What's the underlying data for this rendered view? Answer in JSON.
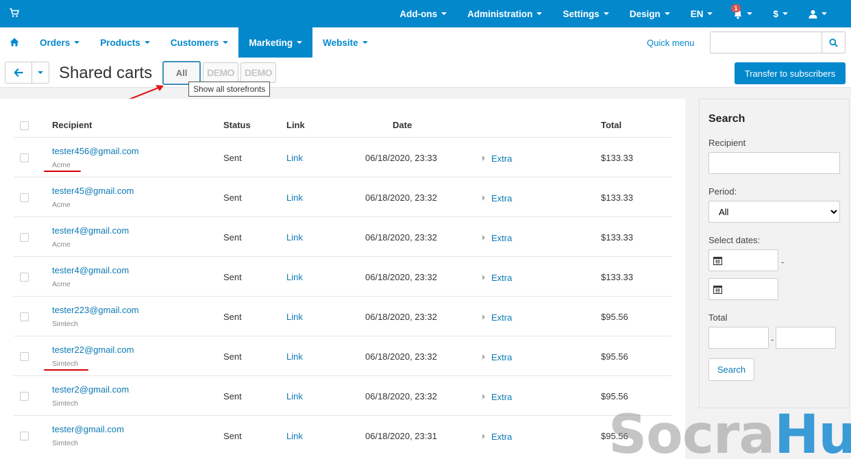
{
  "topbar": {
    "items": [
      {
        "label": "Add-ons"
      },
      {
        "label": "Administration"
      },
      {
        "label": "Settings"
      },
      {
        "label": "Design"
      },
      {
        "label": "EN"
      }
    ],
    "notification_count": "1",
    "currency": "$",
    "accent_color": "#0388cc"
  },
  "nav": {
    "items": [
      {
        "label": "Orders"
      },
      {
        "label": "Products"
      },
      {
        "label": "Customers"
      },
      {
        "label": "Marketing"
      },
      {
        "label": "Website"
      }
    ],
    "active": "Marketing",
    "quick_menu": "Quick menu",
    "search_placeholder": ""
  },
  "header": {
    "title": "Shared carts",
    "storefront_all": "All",
    "storefront_logos": [
      "DEMO",
      "DEMO"
    ],
    "tooltip": "Show all storefronts",
    "transfer_button": "Transfer to subscribers"
  },
  "table": {
    "columns": {
      "recipient": "Recipient",
      "status": "Status",
      "link": "Link",
      "date": "Date",
      "total": "Total"
    },
    "rows": [
      {
        "email": "tester456@gmail.com",
        "store": "Acme",
        "status": "Sent",
        "link": "Link",
        "date": "06/18/2020, 23:33",
        "extra": "Extra",
        "total": "$133.33"
      },
      {
        "email": "tester45@gmail.com",
        "store": "Acme",
        "status": "Sent",
        "link": "Link",
        "date": "06/18/2020, 23:32",
        "extra": "Extra",
        "total": "$133.33"
      },
      {
        "email": "tester4@gmail.com",
        "store": "Acme",
        "status": "Sent",
        "link": "Link",
        "date": "06/18/2020, 23:32",
        "extra": "Extra",
        "total": "$133.33"
      },
      {
        "email": "tester4@gmail.com",
        "store": "Acme",
        "status": "Sent",
        "link": "Link",
        "date": "06/18/2020, 23:32",
        "extra": "Extra",
        "total": "$133.33"
      },
      {
        "email": "tester223@gmail.com",
        "store": "Simtech",
        "status": "Sent",
        "link": "Link",
        "date": "06/18/2020, 23:32",
        "extra": "Extra",
        "total": "$95.56"
      },
      {
        "email": "tester22@gmail.com",
        "store": "Simtech",
        "status": "Sent",
        "link": "Link",
        "date": "06/18/2020, 23:32",
        "extra": "Extra",
        "total": "$95.56"
      },
      {
        "email": "tester2@gmail.com",
        "store": "Simtech",
        "status": "Sent",
        "link": "Link",
        "date": "06/18/2020, 23:32",
        "extra": "Extra",
        "total": "$95.56"
      },
      {
        "email": "tester@gmail.com",
        "store": "Simtech",
        "status": "Sent",
        "link": "Link",
        "date": "06/18/2020, 23:31",
        "extra": "Extra",
        "total": "$95.56"
      }
    ]
  },
  "search": {
    "title": "Search",
    "recipient_label": "Recipient",
    "period_label": "Period:",
    "period_value": "All",
    "select_dates_label": "Select dates:",
    "total_label": "Total",
    "button": "Search"
  },
  "watermark": {
    "part1": "Socra",
    "part2": "Hub"
  }
}
